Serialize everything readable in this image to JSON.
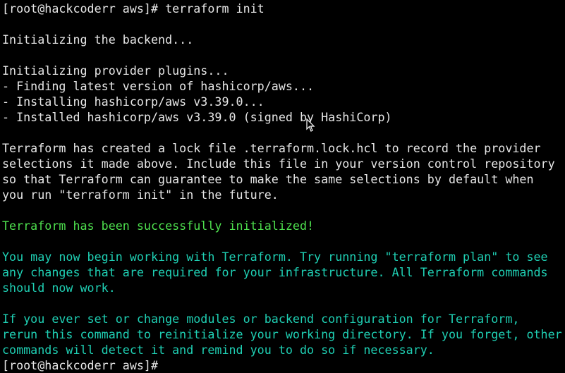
{
  "terminal": {
    "lines": [
      {
        "text": "[root@hackcoderr aws]# terraform init",
        "color": "default"
      },
      {
        "text": "",
        "color": "default"
      },
      {
        "text": "Initializing the backend...",
        "color": "default"
      },
      {
        "text": "",
        "color": "default"
      },
      {
        "text": "Initializing provider plugins...",
        "color": "default"
      },
      {
        "text": "- Finding latest version of hashicorp/aws...",
        "color": "default"
      },
      {
        "text": "- Installing hashicorp/aws v3.39.0...",
        "color": "default"
      },
      {
        "text": "- Installed hashicorp/aws v3.39.0 (signed by HashiCorp)",
        "color": "default"
      },
      {
        "text": "",
        "color": "default"
      },
      {
        "text": "Terraform has created a lock file .terraform.lock.hcl to record the provider",
        "color": "default"
      },
      {
        "text": "selections it made above. Include this file in your version control repository",
        "color": "default"
      },
      {
        "text": "so that Terraform can guarantee to make the same selections by default when",
        "color": "default"
      },
      {
        "text": "you run \"terraform init\" in the future.",
        "color": "default"
      },
      {
        "text": "",
        "color": "default"
      },
      {
        "text": "Terraform has been successfully initialized!",
        "color": "green"
      },
      {
        "text": "",
        "color": "default"
      },
      {
        "text": "You may now begin working with Terraform. Try running \"terraform plan\" to see",
        "color": "cyan"
      },
      {
        "text": "any changes that are required for your infrastructure. All Terraform commands",
        "color": "cyan"
      },
      {
        "text": "should now work.",
        "color": "cyan"
      },
      {
        "text": "",
        "color": "default"
      },
      {
        "text": "If you ever set or change modules or backend configuration for Terraform,",
        "color": "cyan"
      },
      {
        "text": "rerun this command to reinitialize your working directory. If you forget, other",
        "color": "cyan"
      },
      {
        "text": "commands will detect it and remind you to do so if necessary.",
        "color": "cyan"
      },
      {
        "text": "[root@hackcoderr aws]# ",
        "color": "default"
      }
    ],
    "colors": {
      "default": "#e6e6e6",
      "green": "#4ee04e",
      "cyan": "#1fd0b4",
      "background": "#000000"
    },
    "pointer_icon": "mouse-pointer-icon"
  }
}
